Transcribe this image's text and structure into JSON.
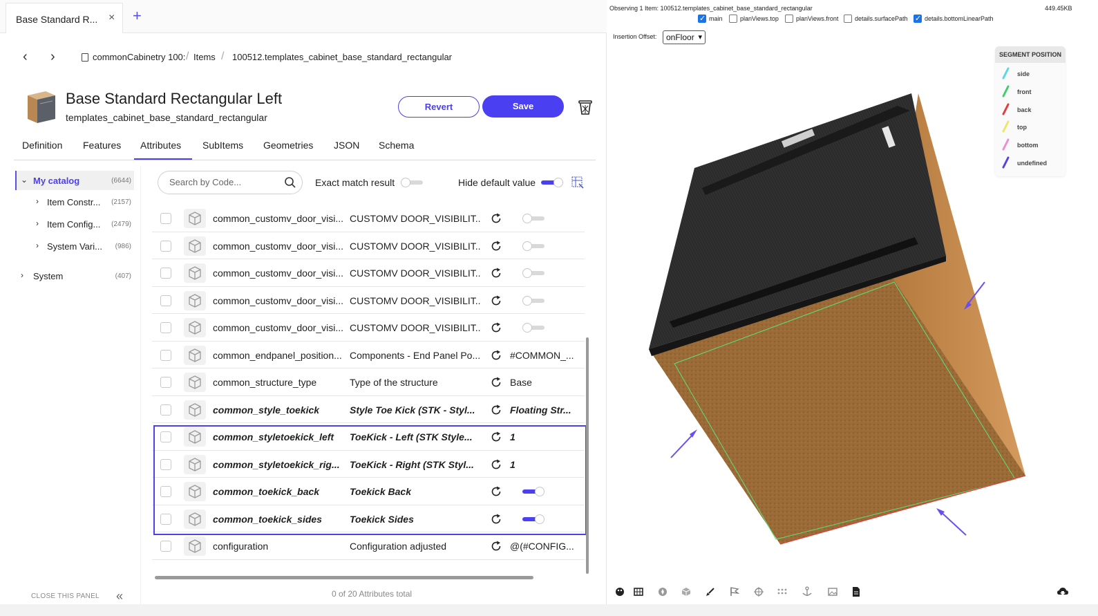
{
  "tab": {
    "title": "Base Standard R...",
    "close": "×",
    "add": "+"
  },
  "breadcrumb": [
    "commonCabinetry 100:",
    "Items",
    "100512.templates_cabinet_base_standard_rectangular"
  ],
  "item": {
    "title": "Base Standard Rectangular Left",
    "subtitle": "templates_cabinet_base_standard_rectangular"
  },
  "actions": {
    "revert": "Revert",
    "save": "Save"
  },
  "section_tabs": [
    "Definition",
    "Features",
    "Attributes",
    "SubItems",
    "Geometries",
    "JSON",
    "Schema"
  ],
  "active_tab": "Attributes",
  "tree": [
    {
      "label": "My catalog",
      "count": "(6644)",
      "expanded": true,
      "selected": true
    },
    {
      "label": "Item Constr...",
      "count": "(2157)"
    },
    {
      "label": "Item Config...",
      "count": "(2479)"
    },
    {
      "label": "System Vari...",
      "count": "(986)"
    },
    {
      "label": "System",
      "count": "(407)"
    }
  ],
  "close_panel": "CLOSE THIS PANEL",
  "filters": {
    "search_placeholder": "Search by Code...",
    "exact_match": "Exact match result",
    "exact_match_on": false,
    "hide_default": "Hide default value",
    "hide_default_on": true
  },
  "attributes": [
    {
      "code": "common_customv_door_visi...",
      "desc": "CUSTOMV DOOR_VISIBILIT...",
      "value_type": "toggle",
      "value": false,
      "bold": false
    },
    {
      "code": "common_customv_door_visi...",
      "desc": "CUSTOMV DOOR_VISIBILIT...",
      "value_type": "toggle",
      "value": false,
      "bold": false
    },
    {
      "code": "common_customv_door_visi...",
      "desc": "CUSTOMV DOOR_VISIBILIT...",
      "value_type": "toggle",
      "value": false,
      "bold": false
    },
    {
      "code": "common_customv_door_visi...",
      "desc": "CUSTOMV DOOR_VISIBILIT...",
      "value_type": "toggle",
      "value": false,
      "bold": false
    },
    {
      "code": "common_customv_door_visi...",
      "desc": "CUSTOMV DOOR_VISIBILIT...",
      "value_type": "toggle",
      "value": false,
      "bold": false
    },
    {
      "code": "common_endpanel_position...",
      "desc": "Components - End Panel Po...",
      "value_type": "text",
      "value": "#COMMON_...",
      "bold": false
    },
    {
      "code": "common_structure_type",
      "desc": "Type of the structure",
      "value_type": "text",
      "value": "Base",
      "bold": false
    },
    {
      "code": "common_style_toekick",
      "desc": "Style Toe Kick (STK - Styl...",
      "value_type": "text",
      "value": "Floating Str...",
      "bold": true
    },
    {
      "code": "common_styletoekick_left",
      "desc": "ToeKick - Left (STK Style...",
      "value_type": "text",
      "value": "1",
      "bold": true
    },
    {
      "code": "common_styletoekick_rig...",
      "desc": "ToeKick - Right (STK Styl...",
      "value_type": "text",
      "value": "1",
      "bold": true
    },
    {
      "code": "common_toekick_back",
      "desc": "Toekick Back",
      "value_type": "toggle",
      "value": true,
      "bold": true
    },
    {
      "code": "common_toekick_sides",
      "desc": "Toekick Sides",
      "value_type": "toggle",
      "value": true,
      "bold": true
    },
    {
      "code": "configuration",
      "desc": "Configuration adjusted",
      "value_type": "text",
      "value": "@(#CONFIG...",
      "bold": false
    }
  ],
  "table_footer": "0 of 20 Attributes total",
  "viewer": {
    "observing": "Observing 1 Item: 100512.templates_cabinet_base_standard_rectangular",
    "size": "449.45KB",
    "layers": [
      {
        "label": "main",
        "checked": true
      },
      {
        "label": "planViews.top",
        "checked": false
      },
      {
        "label": "planViews.front",
        "checked": false
      },
      {
        "label": "details.surfacePath",
        "checked": false
      },
      {
        "label": "details.bottomLinearPath",
        "checked": true
      }
    ],
    "insertion_offset_label": "Insertion Offset:",
    "insertion_offset_value": "onFloor",
    "legend_title": "SEGMENT POSITION",
    "legend": [
      {
        "label": "side",
        "color": "#5ad8e6"
      },
      {
        "label": "front",
        "color": "#3ecf6a"
      },
      {
        "label": "back",
        "color": "#e53b3b"
      },
      {
        "label": "top",
        "color": "#efe56a"
      },
      {
        "label": "bottom",
        "color": "#ec8fcf"
      },
      {
        "label": "undefined",
        "color": "#5b3fe0"
      }
    ],
    "toolbar_icons": [
      "palette-icon",
      "grid-icon",
      "compass-icon",
      "cube-icon",
      "brush-icon",
      "flag-icon",
      "crosshair-icon",
      "dots-grid-icon",
      "anchor-icon",
      "image-icon",
      "document-icon"
    ]
  },
  "colors": {
    "accent": "#4b3ff2",
    "cabinet_top": "#2a2a2a",
    "cabinet_side": "#c58a4e",
    "cabinet_bottom": "#9a6a35"
  }
}
